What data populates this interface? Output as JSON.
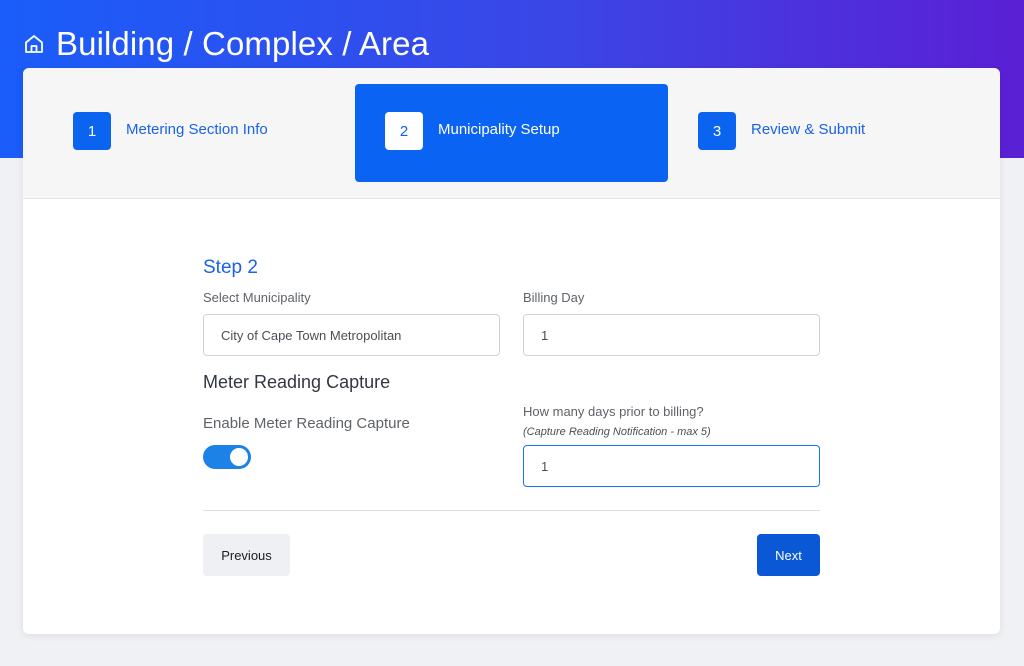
{
  "header": {
    "title": "Building / Complex / Area",
    "icon": "home-icon"
  },
  "stepper": {
    "steps": [
      {
        "number": "1",
        "label": "Metering Section Info",
        "active": false
      },
      {
        "number": "2",
        "label": "Municipality Setup",
        "active": true
      },
      {
        "number": "3",
        "label": "Review & Submit",
        "active": false
      }
    ]
  },
  "form": {
    "step_heading": "Step 2",
    "municipality": {
      "label": "Select Municipality",
      "value": "City of Cape Town Metropolitan"
    },
    "billing_day": {
      "label": "Billing Day",
      "value": "1"
    },
    "meter_reading": {
      "section_title": "Meter Reading Capture",
      "toggle_label": "Enable Meter Reading Capture",
      "toggle_enabled": true
    },
    "days_prior": {
      "label": "How many days prior to billing?",
      "hint": "(Capture Reading Notification - max 5)",
      "value": "1"
    }
  },
  "actions": {
    "previous_label": "Previous",
    "next_label": "Next"
  },
  "colors": {
    "primary": "#0a63f2",
    "gradient_start": "#1a5dfa",
    "gradient_end": "#5b1fd4",
    "toggle_on": "#1c82e8"
  }
}
